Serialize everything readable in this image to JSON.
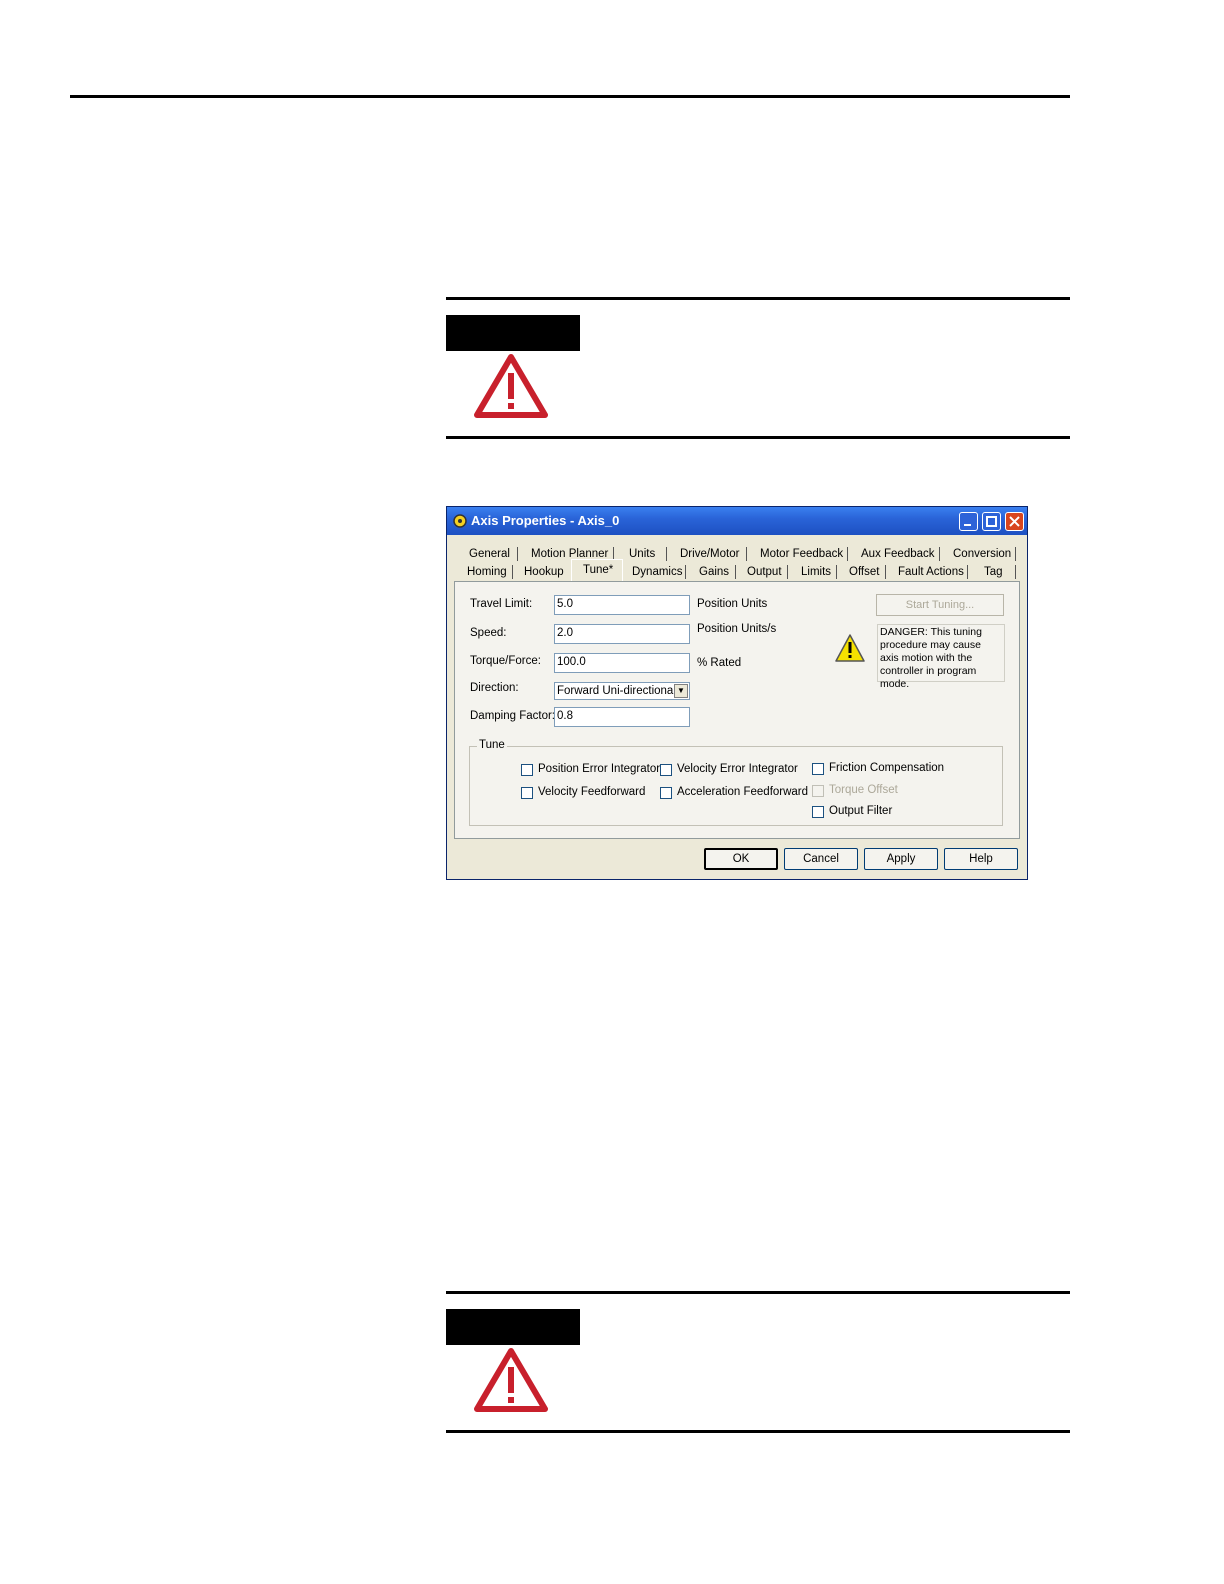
{
  "dialog": {
    "title": "Axis Properties - Axis_0",
    "tabs_row1": [
      "General",
      "Motion Planner",
      "Units",
      "Drive/Motor",
      "Motor Feedback",
      "Aux Feedback",
      "Conversion"
    ],
    "tabs_row2": [
      "Homing",
      "Hookup",
      "Tune*",
      "Dynamics",
      "Gains",
      "Output",
      "Limits",
      "Offset",
      "Fault Actions",
      "Tag"
    ],
    "fields": {
      "travel_limit": {
        "label": "Travel Limit:",
        "value": "5.0",
        "unit": "Position Units"
      },
      "speed": {
        "label": "Speed:",
        "value": "2.0",
        "unit": "Position Units/s"
      },
      "torque_force": {
        "label": "Torque/Force:",
        "value": "100.0",
        "unit": "% Rated"
      },
      "direction": {
        "label": "Direction:",
        "value": "Forward Uni-directional"
      },
      "damping_factor": {
        "label": "Damping Factor:",
        "value": "0.8"
      }
    },
    "start_tuning_label": "Start Tuning...",
    "danger_text": "DANGER: This tuning procedure may cause axis motion with the controller in program mode.",
    "tune_group": {
      "title": "Tune",
      "options": {
        "position_error_integrator": "Position Error Integrator",
        "velocity_error_integrator": "Velocity Error Integrator",
        "friction_compensation": "Friction Compensation",
        "velocity_feedforward": "Velocity Feedforward",
        "acceleration_feedforward": "Acceleration Feedforward",
        "torque_offset": "Torque Offset",
        "output_filter": "Output Filter"
      }
    },
    "buttons": {
      "ok": "OK",
      "cancel": "Cancel",
      "apply": "Apply",
      "help": "Help"
    }
  },
  "colors": {
    "titlebar": "#2a64d8",
    "warning_red": "#c8202c",
    "dialog_bg": "#ece9d8"
  }
}
